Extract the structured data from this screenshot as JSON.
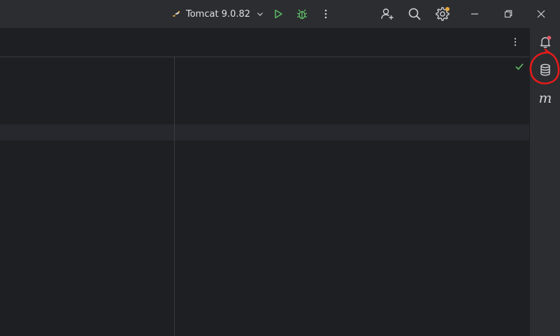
{
  "toolbar": {
    "run_config": "Tomcat 9.0.82"
  },
  "icons": {
    "run_config": "tomcat-cat-icon",
    "run": "run-play-icon",
    "debug": "debug-bug-icon",
    "more": "more-vertical-icon",
    "add_user": "add-user-icon",
    "search": "search-icon",
    "settings": "gear-icon",
    "minimize": "minimize-icon",
    "restore": "restore-icon",
    "close": "close-icon",
    "notifications": "bell-icon",
    "database": "database-icon",
    "inspection_ok": "check-icon"
  },
  "right_strip": {
    "maven_label": "m"
  },
  "colors": {
    "background": "#1e1f22",
    "chrome": "#2b2d30",
    "run_green": "#5fb865",
    "badge_orange": "#e5a93c",
    "badge_red": "#e55765",
    "annotation_red": "#e51b1b"
  }
}
